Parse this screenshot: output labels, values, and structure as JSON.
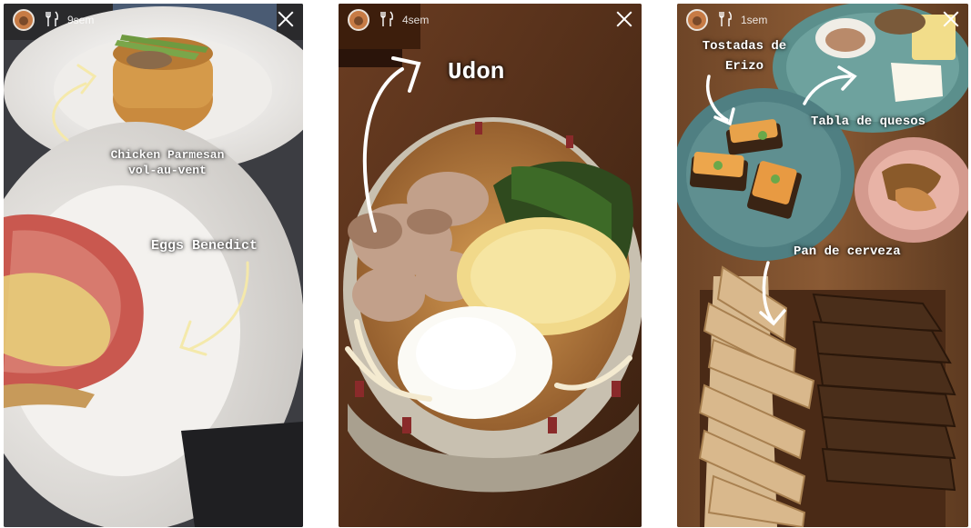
{
  "stories": [
    {
      "time": "9sem",
      "captions": {
        "chicken_line1": "Chicken Parmesan",
        "chicken_line2": "vol-au-vent",
        "eggs": "Eggs Benedict"
      }
    },
    {
      "time": "4sem",
      "captions": {
        "udon": "Udon"
      }
    },
    {
      "time": "1sem",
      "captions": {
        "tostadas_line1": "Tostadas de",
        "tostadas_line2": "Erizo",
        "quesos": "Tabla de quesos",
        "pan": "Pan de cerveza"
      }
    }
  ],
  "icons": {
    "avatar": "profile-avatar",
    "cutlery": "fork-knife-icon",
    "close": "close-icon"
  },
  "colors": {
    "caption_text": "#ffffff",
    "arrow_glow": "#f5e9a8"
  }
}
